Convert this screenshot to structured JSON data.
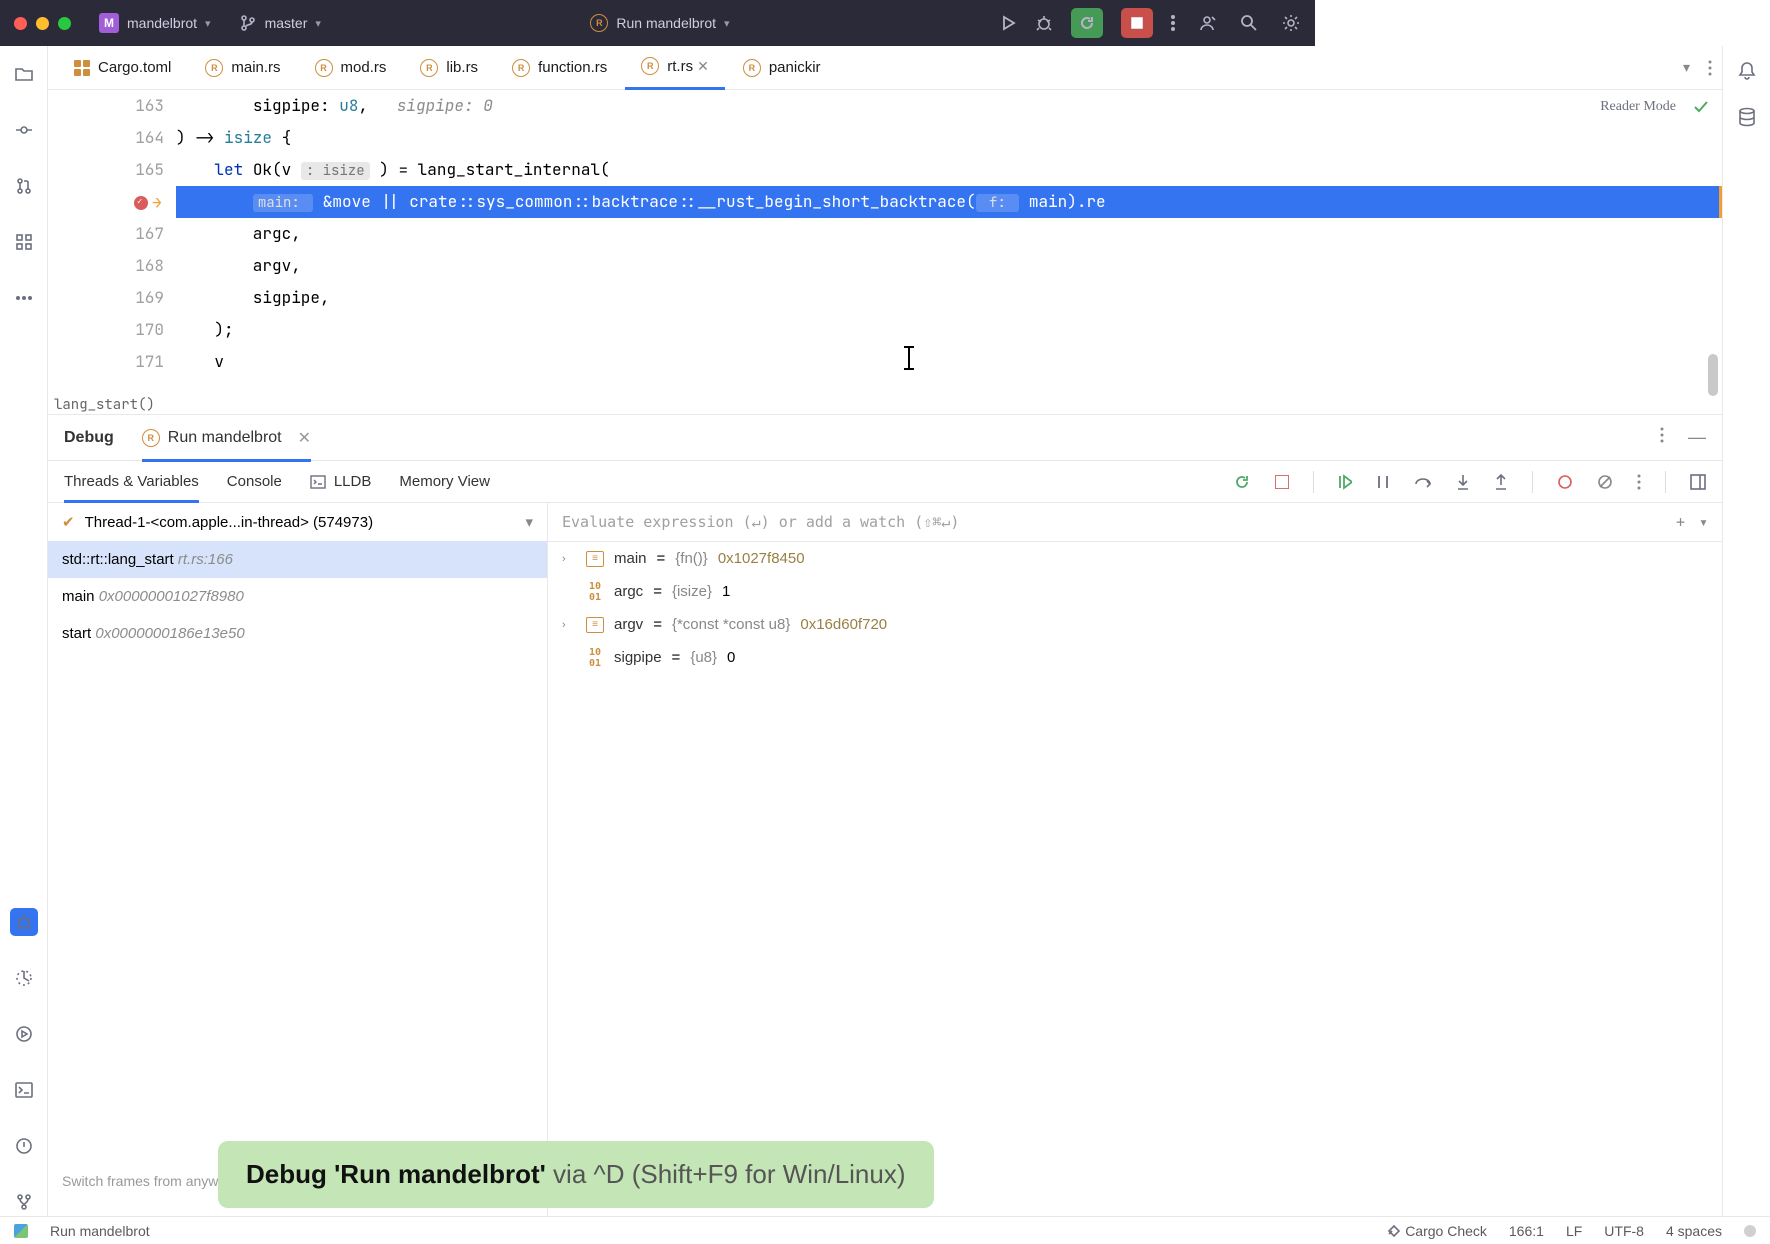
{
  "titlebar": {
    "project_badge": "M",
    "project_name": "mandelbrot",
    "branch": "master",
    "run_config": "Run mandelbrot"
  },
  "tabs": [
    {
      "icon": "cargo",
      "label": "Cargo.toml"
    },
    {
      "icon": "rust",
      "label": "main.rs"
    },
    {
      "icon": "rust",
      "label": "mod.rs"
    },
    {
      "icon": "rust",
      "label": "lib.rs"
    },
    {
      "icon": "rust",
      "label": "function.rs"
    },
    {
      "icon": "rust",
      "label": "rt.rs",
      "active": true
    },
    {
      "icon": "rust",
      "label": "panickir"
    }
  ],
  "editor": {
    "reader_mode": "Reader Mode",
    "lines": {
      "163": {
        "pre_indent": "        ",
        "sigpipe": "sigpipe: ",
        "u8": "u8",
        "comma": ",   ",
        "inlay": "sigpipe: 0"
      },
      "164": {
        "text": ") -> ",
        "ty": "isize",
        "rest": " {"
      },
      "165": {
        "pre": "    ",
        "kw": "let ",
        "ok": "Ok",
        "paren": "(v ",
        "hint": ": isize",
        "close": " ) = lang_start_internal("
      },
      "166": {
        "hint": "main: ",
        "code": "&move || crate::sys_common::backtrace::__rust_begin_short_backtrace(",
        "hint2": " f: ",
        "tail": "main).re"
      },
      "167": "        argc,",
      "168": "        argv,",
      "169": "        sigpipe,",
      "170": "    );",
      "171": "    v"
    },
    "breadcrumb": "lang_start()"
  },
  "debug": {
    "tab_debug": "Debug",
    "tab_run": "Run mandelbrot",
    "tools": {
      "threads": "Threads & Variables",
      "console": "Console",
      "lldb": "LLDB",
      "memory": "Memory View"
    },
    "thread_header": "Thread-1-<com.apple...in-thread> (574973)",
    "frames": [
      {
        "name": "std::rt::lang_start",
        "loc": "rt.rs:166",
        "sel": true
      },
      {
        "name": "main",
        "loc": "0x00000001027f8980"
      },
      {
        "name": "start",
        "loc": "0x0000000186e13e50"
      }
    ],
    "eval_placeholder": "Evaluate expression (↵) or add a watch (⇧⌘↵)",
    "vars": [
      {
        "expand": true,
        "icon": "struct",
        "name": "main",
        "eq": " = ",
        "type": "{fn()}",
        "val": " 0x1027f8450"
      },
      {
        "expand": false,
        "icon": "prim",
        "name": "argc",
        "eq": " = ",
        "type": "{isize}",
        "val": " 1",
        "plain": true
      },
      {
        "expand": true,
        "icon": "struct",
        "name": "argv",
        "eq": " = ",
        "type": "{*const *const u8}",
        "val": " 0x16d60f720"
      },
      {
        "expand": false,
        "icon": "prim",
        "name": "sigpipe",
        "eq": " = ",
        "type": "{u8}",
        "val": " 0",
        "plain": true
      }
    ],
    "tip": "Switch frames from anywhere in the IDE with ⌃⌘↑ and"
  },
  "hint": {
    "bold": "Debug 'Run mandelbrot'",
    "rest": " via ^D (Shift+F9 for Win/Linux)"
  },
  "status": {
    "run": "Run mandelbrot",
    "cargo": "Cargo Check",
    "pos": "166:1",
    "le": "LF",
    "enc": "UTF-8",
    "indent": "4 spaces"
  }
}
